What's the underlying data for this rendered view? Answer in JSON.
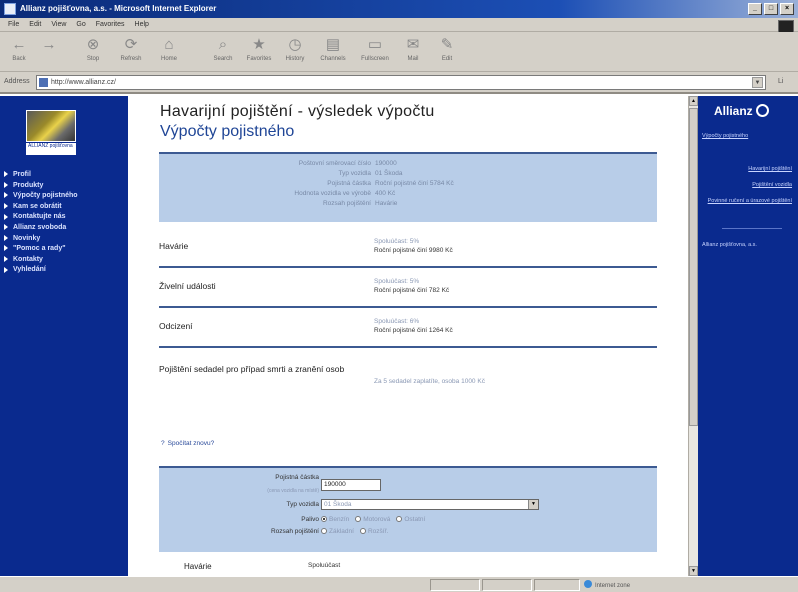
{
  "window": {
    "title": "Allianz pojišťovna, a.s. - Microsoft Internet Explorer",
    "controls": [
      "_",
      "□",
      "×"
    ]
  },
  "menu": [
    "File",
    "Edit",
    "View",
    "Go",
    "Favorites",
    "Help"
  ],
  "toolbar": [
    {
      "label": "Back",
      "icon": "back-arrow-icon",
      "glyph": "←"
    },
    {
      "label": "",
      "icon": "forward-arrow-icon",
      "glyph": "→"
    },
    {
      "label": "Stop",
      "icon": "stop-icon",
      "glyph": "⊗"
    },
    {
      "label": "Refresh",
      "icon": "refresh-icon",
      "glyph": "⟳"
    },
    {
      "label": "Home",
      "icon": "home-icon",
      "glyph": "⌂"
    },
    {
      "label": "Search",
      "icon": "search-icon",
      "glyph": "⌕"
    },
    {
      "label": "Favorites",
      "icon": "favorites-icon",
      "glyph": "★"
    },
    {
      "label": "History",
      "icon": "history-icon",
      "glyph": "◷"
    },
    {
      "label": "Channels",
      "icon": "channels-icon",
      "glyph": "▤"
    },
    {
      "label": "Fullscreen",
      "icon": "fullscreen-icon",
      "glyph": "▭"
    },
    {
      "label": "Mail",
      "icon": "mail-icon",
      "glyph": "✉"
    },
    {
      "label": "Edit",
      "icon": "edit-icon",
      "glyph": "✎"
    }
  ],
  "address": {
    "label": "Address",
    "url": "http://www.allianz.cz/",
    "go": "Li"
  },
  "left_nav": {
    "logo_caption": "ALLIANZ\npojišťovna",
    "items": [
      "Profil",
      "Produkty",
      "Výpočty pojistného",
      "Kam se obrátit",
      "Kontaktujte nás",
      "Allianz svoboda",
      "Novinky",
      "\"Pomoc a rady\"",
      "Kontakty",
      "Vyhledání"
    ]
  },
  "main": {
    "title": "Havarijní pojištění - výsledek výpočtu",
    "subtitle": "Výpočty pojistného",
    "summary": [
      {
        "label": "Poštovní směrovací číslo",
        "value": "190000"
      },
      {
        "label": "Typ vozidla",
        "value": "01 Škoda"
      },
      {
        "label": "Pojistná částka",
        "value": "Roční pojistné činí 5784 Kč"
      },
      {
        "label": "Hodnota vozidla ve výrobě",
        "value": "400 Kč"
      },
      {
        "label": "Rozsah pojištění",
        "value": "Havárie"
      }
    ],
    "results": [
      {
        "name": "Havárie",
        "status": "Spoluúčast: 5%",
        "detail": "Roční pojistné činí 9980 Kč"
      },
      {
        "name": "Živelní události",
        "status": "Spoluúčast: 5%",
        "detail": "Roční pojistné činí 782 Kč"
      },
      {
        "name": "Odcizení",
        "status": "Spoluúčast: 6%",
        "detail": "Roční pojistné činí 1264 Kč"
      }
    ],
    "liability": {
      "name": "Pojištění sedadel pro případ smrti a zranění osob",
      "note": "Za 5 sedadel zaplatíte, osoba 1000 Kč"
    },
    "recalc_link": "Spočítat znovu?",
    "form": {
      "postal_label": "Pojistná částka",
      "postal_hint": "(cena vozidla na místě)",
      "postal_value": "190000",
      "vehicle_label": "Typ vozidla",
      "vehicle_value": "01 Škoda",
      "fuel_label": "Palivo",
      "fuel_options": [
        "Benzín",
        "Motorová",
        "Ostatní"
      ],
      "fuel_selected": 0,
      "scope_label": "Rozsah pojištění",
      "scope_options": [
        "Základní",
        "Rozšíř."
      ],
      "scope_selected": -1
    },
    "bottom_row": {
      "name": "Havárie",
      "status": "Spoluúčast"
    }
  },
  "right_bar": {
    "brand": "Allianz",
    "heading": "Výpočty pojistného",
    "links": [
      "Havarijní pojištění",
      "Pojištění vozidla",
      "Povinné ručení a úrazové pojištění"
    ],
    "company": "Allianz pojišťovna, a.s."
  },
  "status_bar": {
    "text": "",
    "zone": "Internet zone"
  },
  "colors": {
    "nav_blue": "#0a2a8e",
    "panel_blue": "#b8cde8",
    "rule_blue": "#3c5a92",
    "title_blue": "#1f4596"
  }
}
